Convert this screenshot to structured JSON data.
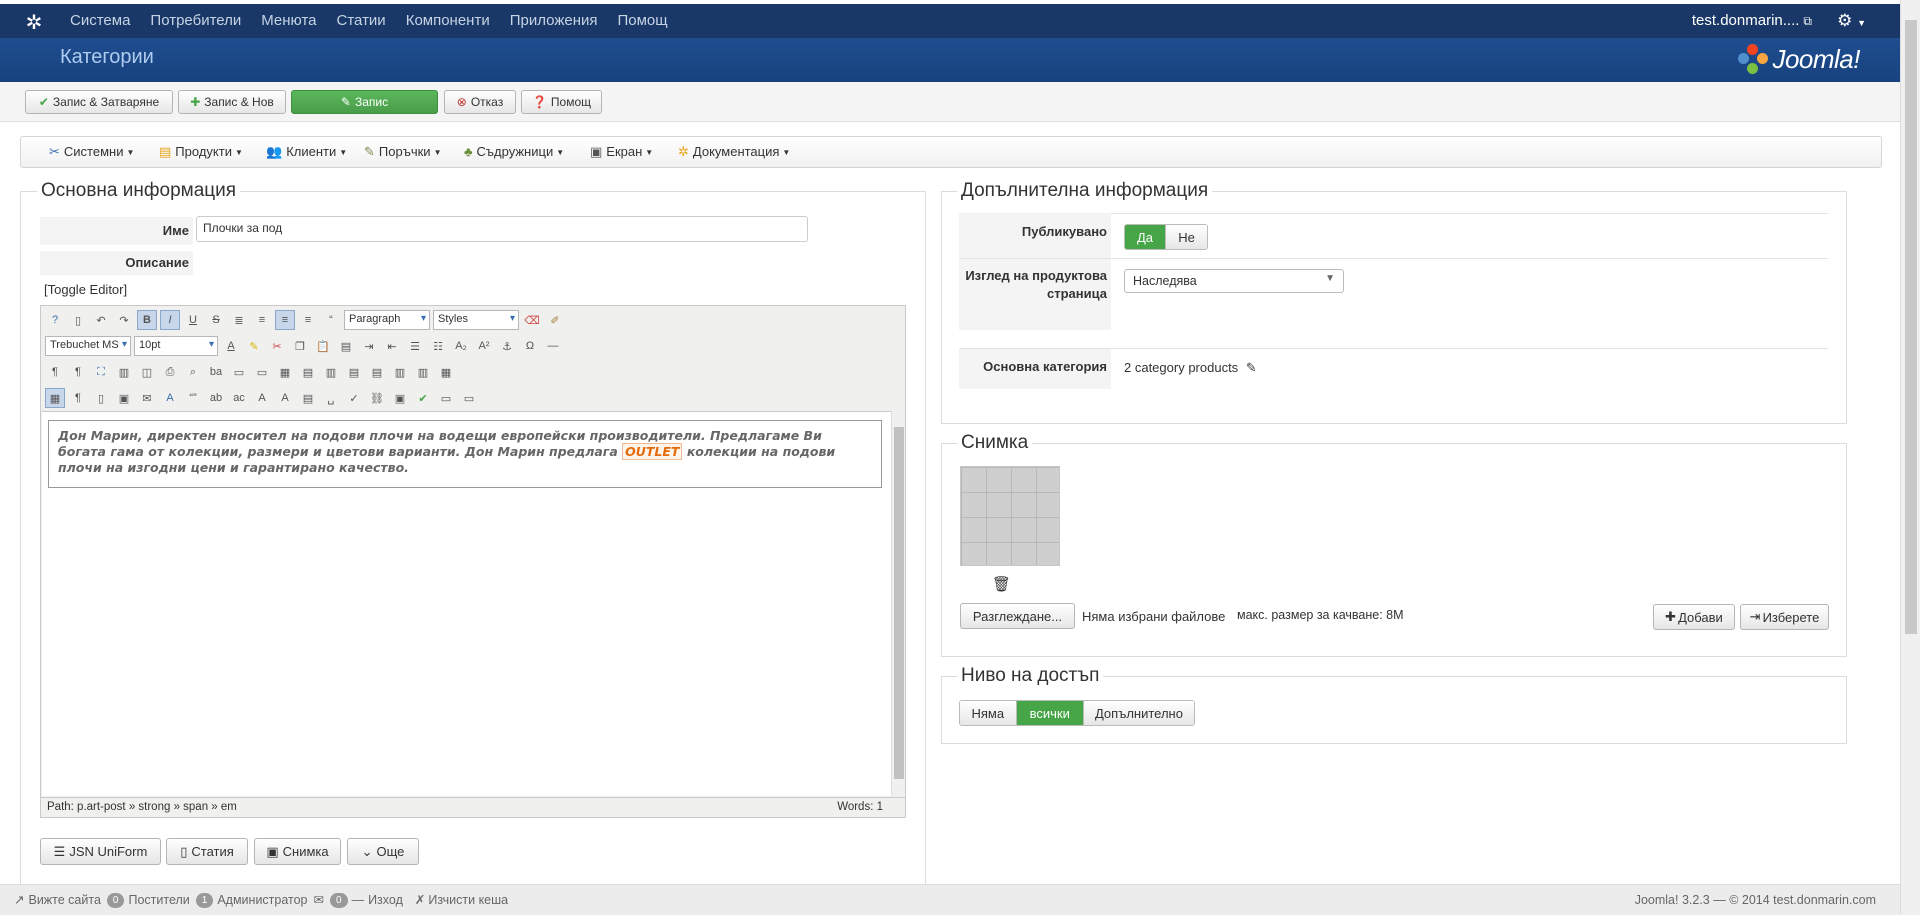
{
  "topbar": {
    "menu": [
      "Система",
      "Потребители",
      "Менюта",
      "Статии",
      "Компоненти",
      "Приложения",
      "Помощ"
    ],
    "user": "test.donmarin...."
  },
  "header": {
    "title": "Категории",
    "logo_text": "Joomla!"
  },
  "toolbar": {
    "save_close": "Запис & Затваряне",
    "save_new": "Запис & Нов",
    "save": "Запис",
    "cancel": "Отказ",
    "help": "Помощ"
  },
  "component_menu": [
    "Системни",
    "Продукти",
    "Клиенти",
    "Поръчки",
    "Съдружници",
    "Екран",
    "Документация"
  ],
  "basic": {
    "legend": "Основна информация",
    "name_label": "Име",
    "name_value": "Плочки за под",
    "description_label": "Описание",
    "toggle_editor": "[Toggle Editor]"
  },
  "editor": {
    "format_value": "Paragraph",
    "styles_value": "Styles",
    "font_value": "Trebuchet MS",
    "size_value": "10pt",
    "content_before": "Дон Марин, директен вносител на подови плочи на водещи европейски производители. Предлагаме Ви богата гама от колекции, размери и цветови варианти. Дон Марин предлага ",
    "content_highlight": "OUTLET",
    "content_after": " колекции на подови плочи на изгодни цени и гарантирано качество.",
    "path": "Path:  p.art-post » strong » span » em",
    "words": "Words: 1"
  },
  "bottom_buttons": {
    "uniform": "JSN UniForm",
    "article": "Статия",
    "image": "Снимка",
    "more": "Още"
  },
  "extra": {
    "legend": "Допълнителна информация",
    "published_label": "Публикувано",
    "yes": "Да",
    "no": "Не",
    "view_label": "Изглед на продуктова страница",
    "view_value": "Наследява",
    "main_category_label": "Основна категория",
    "main_category_value": "2 category products"
  },
  "image_section": {
    "legend": "Снимка",
    "browse": "Разглеждане...",
    "no_file": "Няма избрани файлове",
    "max_size": "макс. размер за качване: 8M",
    "add": "Добави",
    "select": "Изберете"
  },
  "access": {
    "legend": "Ниво на достъп",
    "options": [
      "Няма",
      "всички",
      "Допълнително"
    ]
  },
  "footer": {
    "view_site": "Вижте сайта",
    "visitors_count": "0",
    "visitors": "Постители",
    "admins_count": "1",
    "admins": "Администратор",
    "messages_count": "0",
    "logout": "Изход",
    "clear_cache": "Изчисти кеша",
    "version": "Joomla! 3.2.3  —  © 2014 test.donmarin.com"
  },
  "colors": {
    "topbar": "#1a3867",
    "header": "#1f4d8f",
    "success": "#46a546",
    "highlight": "#e46b0b"
  }
}
